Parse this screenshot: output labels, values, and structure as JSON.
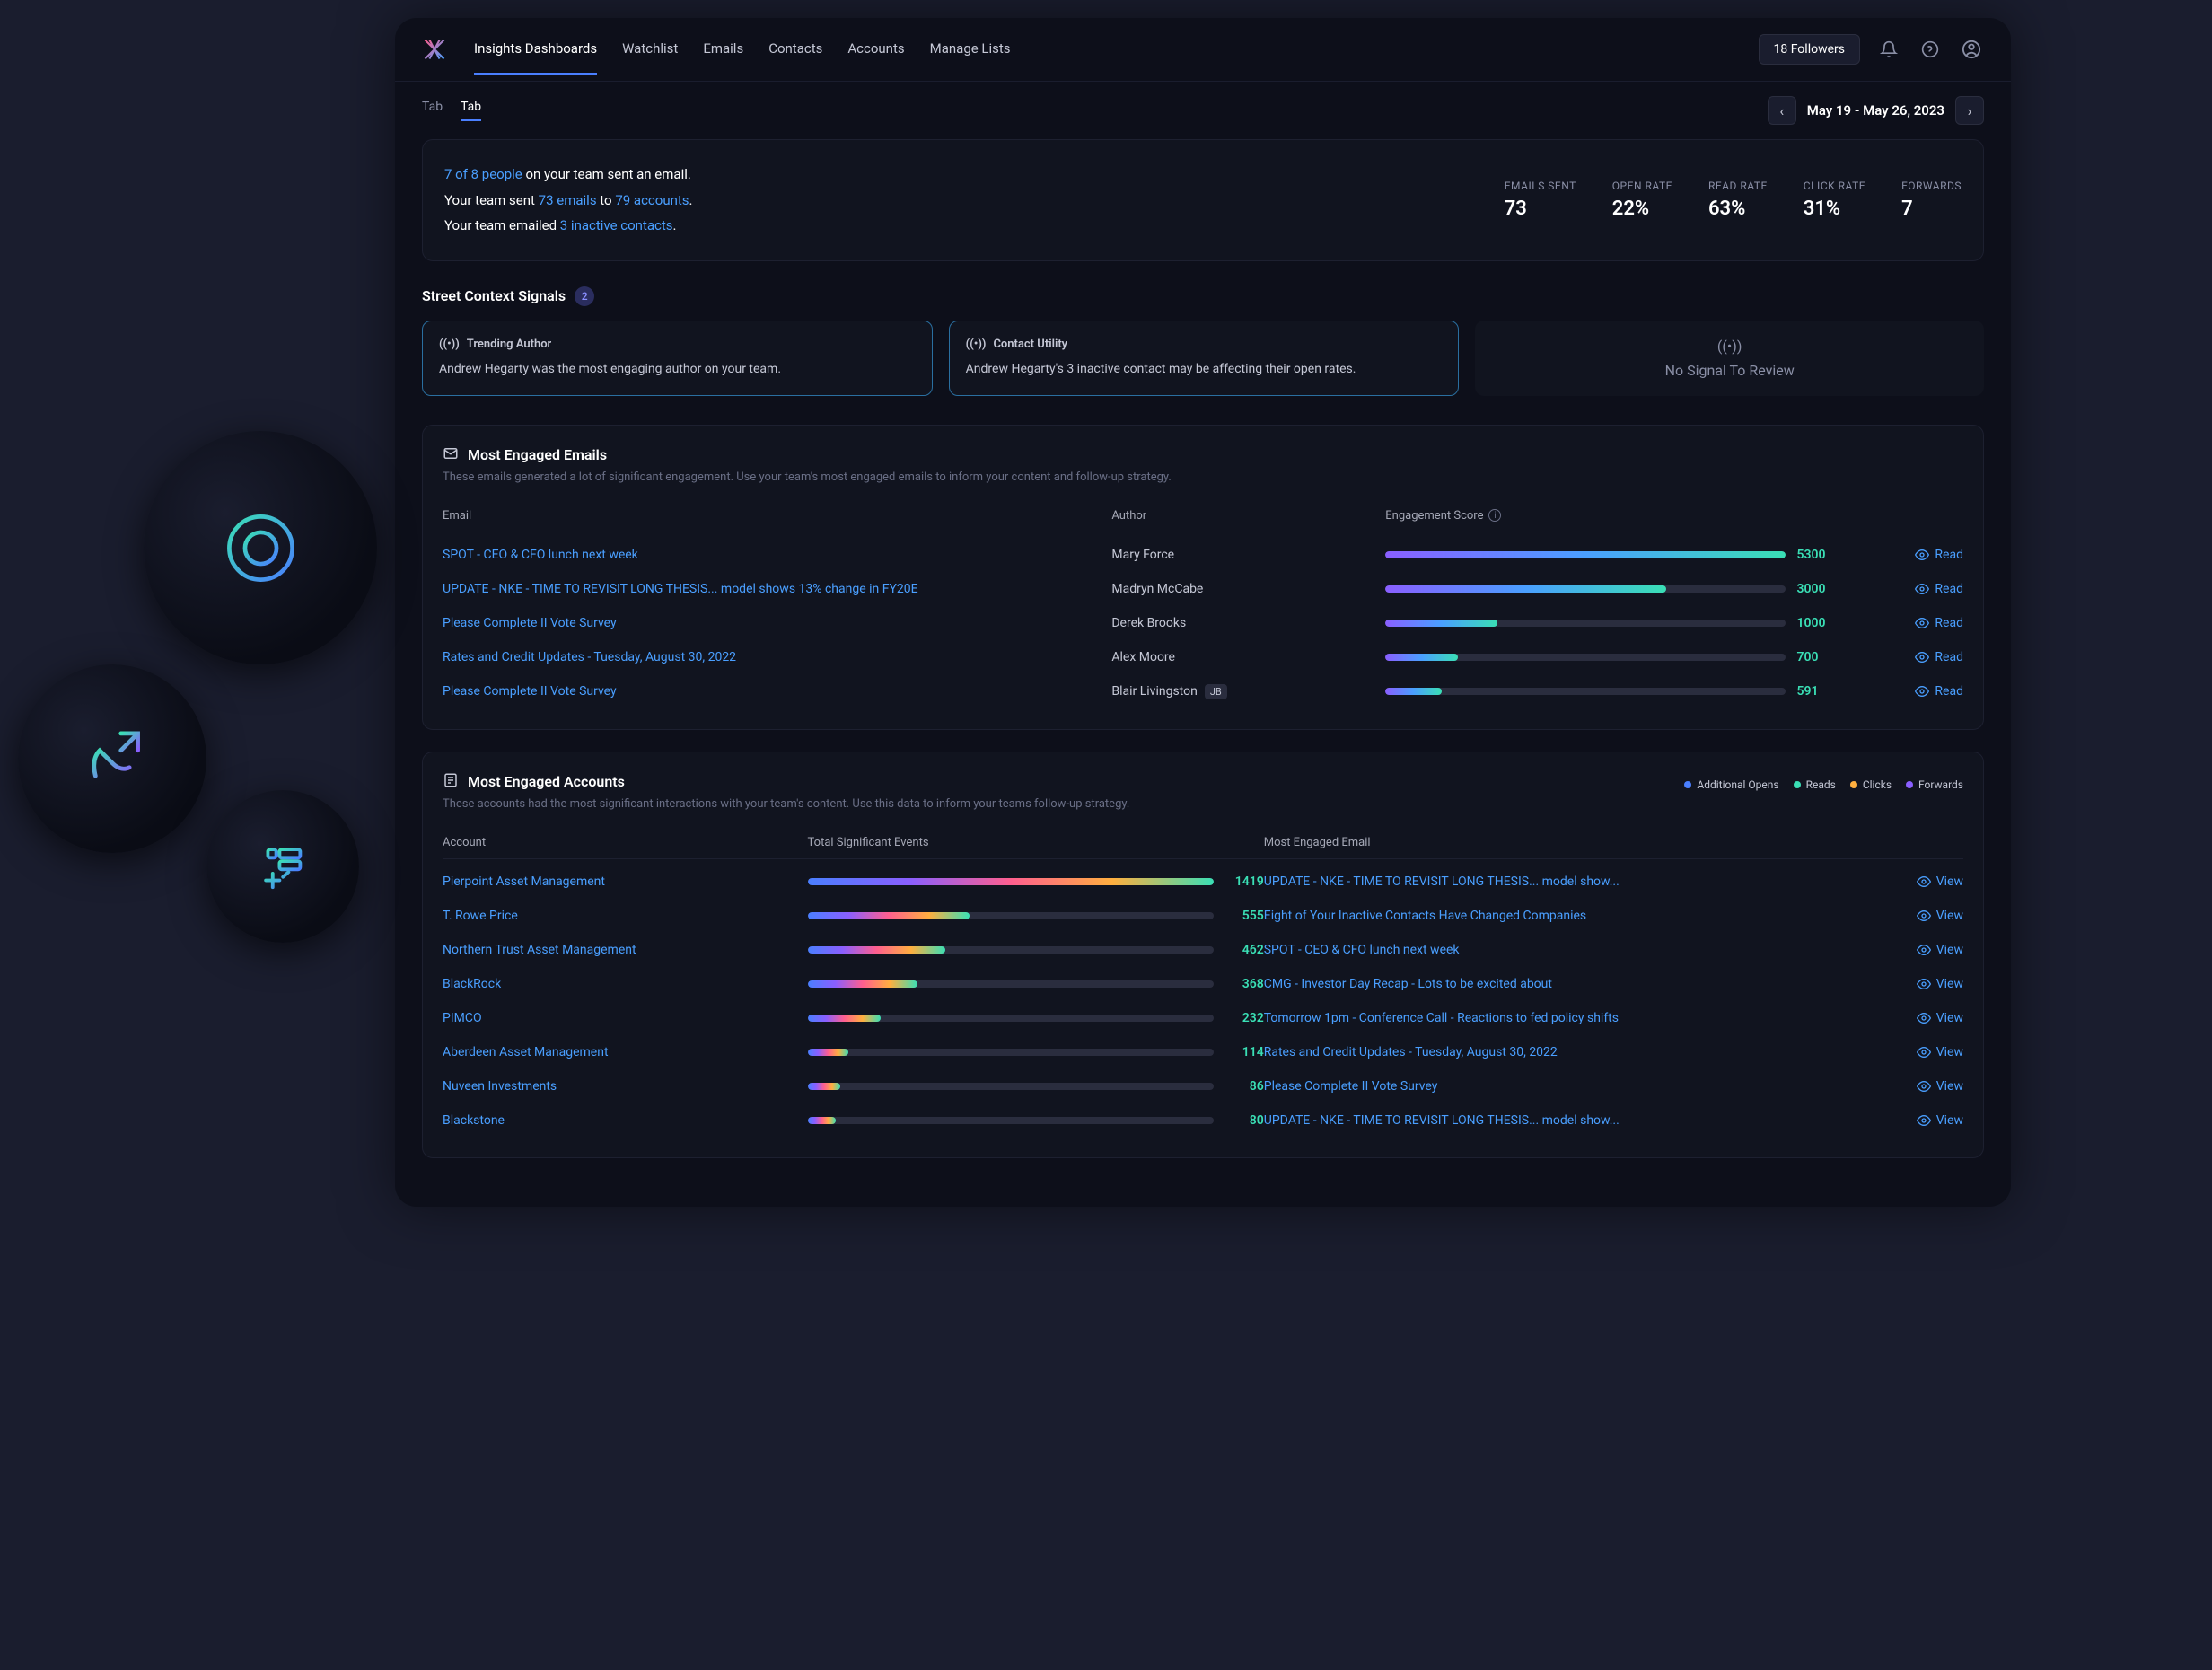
{
  "nav": {
    "items": [
      "Insights Dashboards",
      "Watchlist",
      "Emails",
      "Contacts",
      "Accounts",
      "Manage Lists"
    ],
    "active": 0,
    "followers": "18 Followers"
  },
  "tabs": {
    "items": [
      "Tab",
      "Tab"
    ],
    "active": 1
  },
  "date_range": "May 19 - May 26, 2023",
  "summary": {
    "line1_a": "7 of 8 people",
    "line1_b": " on your team sent an email.",
    "line2_a": "Your team sent ",
    "line2_b": "73 emails",
    "line2_c": " to ",
    "line2_d": "79 accounts",
    "line2_e": ".",
    "line3_a": "Your team emailed ",
    "line3_b": "3 inactive contacts",
    "line3_c": "."
  },
  "stats": [
    {
      "label": "EMAILS SENT",
      "value": "73"
    },
    {
      "label": "OPEN RATE",
      "value": "22%"
    },
    {
      "label": "READ RATE",
      "value": "63%"
    },
    {
      "label": "CLICK RATE",
      "value": "31%"
    },
    {
      "label": "FORWARDS",
      "value": "7"
    }
  ],
  "signals": {
    "title": "Street Context Signals",
    "count": "2",
    "cards": [
      {
        "title": "Trending Author",
        "body": "Andrew Hegarty was the most engaging author on your team."
      },
      {
        "title": "Contact Utility",
        "body": "Andrew Hegarty's 3 inactive contact may be affecting their open rates."
      }
    ],
    "empty": "No Signal To Review"
  },
  "emails_section": {
    "title": "Most Engaged Emails",
    "sub": "These emails generated a lot of significant engagement. Use your team's most engaged emails to inform your content and follow-up strategy.",
    "cols": {
      "email": "Email",
      "author": "Author",
      "score": "Engagement Score"
    },
    "rows": [
      {
        "email": "SPOT - CEO & CFO lunch next week",
        "author": "Mary Force",
        "score": 5300,
        "pct": 100
      },
      {
        "email": "UPDATE - NKE - TIME TO REVISIT LONG THESIS... model shows 13% change in FY20E",
        "author": "Madryn McCabe",
        "score": 3000,
        "pct": 70
      },
      {
        "email": "Please Complete II Vote Survey",
        "author": "Derek Brooks",
        "score": 1000,
        "pct": 28
      },
      {
        "email": "Rates and Credit Updates - Tuesday, August 30, 2022",
        "author": "Alex Moore",
        "score": 700,
        "pct": 18
      },
      {
        "email": "Please Complete II Vote Survey",
        "author": "Blair Livingston",
        "badge": "JB",
        "score": 591,
        "pct": 14
      }
    ],
    "action": "Read"
  },
  "accounts_section": {
    "title": "Most Engaged Accounts",
    "sub": "These accounts had the most significant interactions with your team's content. Use this data to inform your teams follow-up strategy.",
    "legend": [
      {
        "label": "Additional Opens",
        "color": "#4a7fff"
      },
      {
        "label": "Reads",
        "color": "#3adfb5"
      },
      {
        "label": "Clicks",
        "color": "#ffaf3f"
      },
      {
        "label": "Forwards",
        "color": "#8a5fff"
      }
    ],
    "cols": {
      "account": "Account",
      "events": "Total Significant Events",
      "mee": "Most Engaged Email"
    },
    "rows": [
      {
        "account": "Pierpoint Asset Management",
        "events": 1419,
        "pct": 100,
        "mee": "UPDATE - NKE - TIME TO REVISIT LONG THESIS... model show..."
      },
      {
        "account": "T. Rowe Price",
        "events": 555,
        "pct": 40,
        "mee": "Eight of Your Inactive Contacts Have Changed Companies"
      },
      {
        "account": "Northern Trust Asset Management",
        "events": 462,
        "pct": 34,
        "mee": "SPOT - CEO & CFO lunch next week"
      },
      {
        "account": "BlackRock",
        "events": 368,
        "pct": 27,
        "mee": "CMG - Investor Day Recap - Lots to be excited about"
      },
      {
        "account": "PIMCO",
        "events": 232,
        "pct": 18,
        "mee": "Tomorrow 1pm - Conference Call - Reactions to fed policy shifts"
      },
      {
        "account": "Aberdeen Asset Management",
        "events": 114,
        "pct": 10,
        "mee": "Rates and Credit Updates - Tuesday, August 30, 2022"
      },
      {
        "account": "Nuveen Investments",
        "events": 86,
        "pct": 8,
        "mee": "Please Complete II Vote Survey"
      },
      {
        "account": "Blackstone",
        "events": 80,
        "pct": 7,
        "mee": "UPDATE - NKE - TIME TO REVISIT LONG THESIS... model show..."
      }
    ],
    "action": "View"
  }
}
